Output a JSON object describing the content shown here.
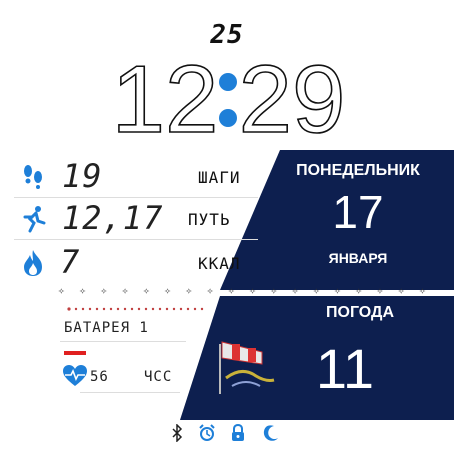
{
  "clock": {
    "seconds": "25",
    "hours": "12",
    "minutes": "29"
  },
  "stats": {
    "steps": {
      "value": "19",
      "label": "ШАГИ"
    },
    "distance": {
      "value": "12,17",
      "label": "ПУТЬ"
    },
    "calories": {
      "value": "7",
      "label": "ККАЛ"
    }
  },
  "date_panel": {
    "weekday": "ПОНЕДЕЛЬНИК",
    "day": "17",
    "month": "ЯНВАРЯ"
  },
  "weather_panel": {
    "title": "ПОГОДА",
    "temperature": "11",
    "icon": "windsock-icon"
  },
  "battery": {
    "label": "БАТАРЕЯ 1",
    "level": 0.01
  },
  "heart": {
    "value": "56",
    "label": "ЧСС"
  },
  "status_icons": [
    "bluetooth-icon",
    "alarm-icon",
    "lock-icon",
    "moon-icon"
  ],
  "colors": {
    "accent": "#1e7fd8",
    "panel": "#0d1f4f",
    "battery_red": "#e02020",
    "text": "#111111"
  }
}
